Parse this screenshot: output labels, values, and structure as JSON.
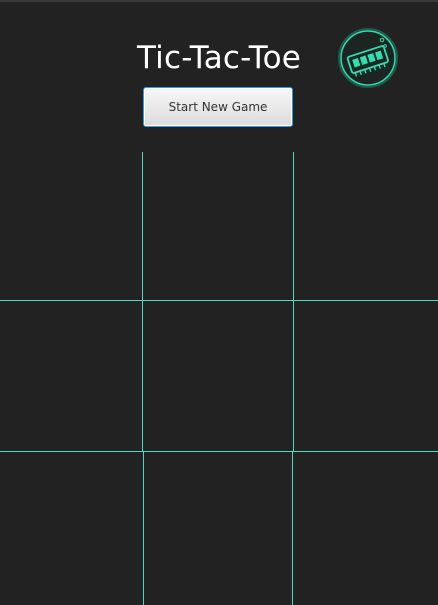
{
  "app": {
    "title": "Tic-Tac-Toe"
  },
  "controls": {
    "new_game_label": "Start New Game"
  },
  "logo": {
    "icon": "memory-chip-icon"
  },
  "board": {
    "rows": 3,
    "cols": 3,
    "cells": [
      "",
      "",
      "",
      "",
      "",
      "",
      "",
      "",
      ""
    ]
  },
  "colors": {
    "background": "#222222",
    "accent": "#4fd9bd",
    "title": "#ffffff"
  }
}
